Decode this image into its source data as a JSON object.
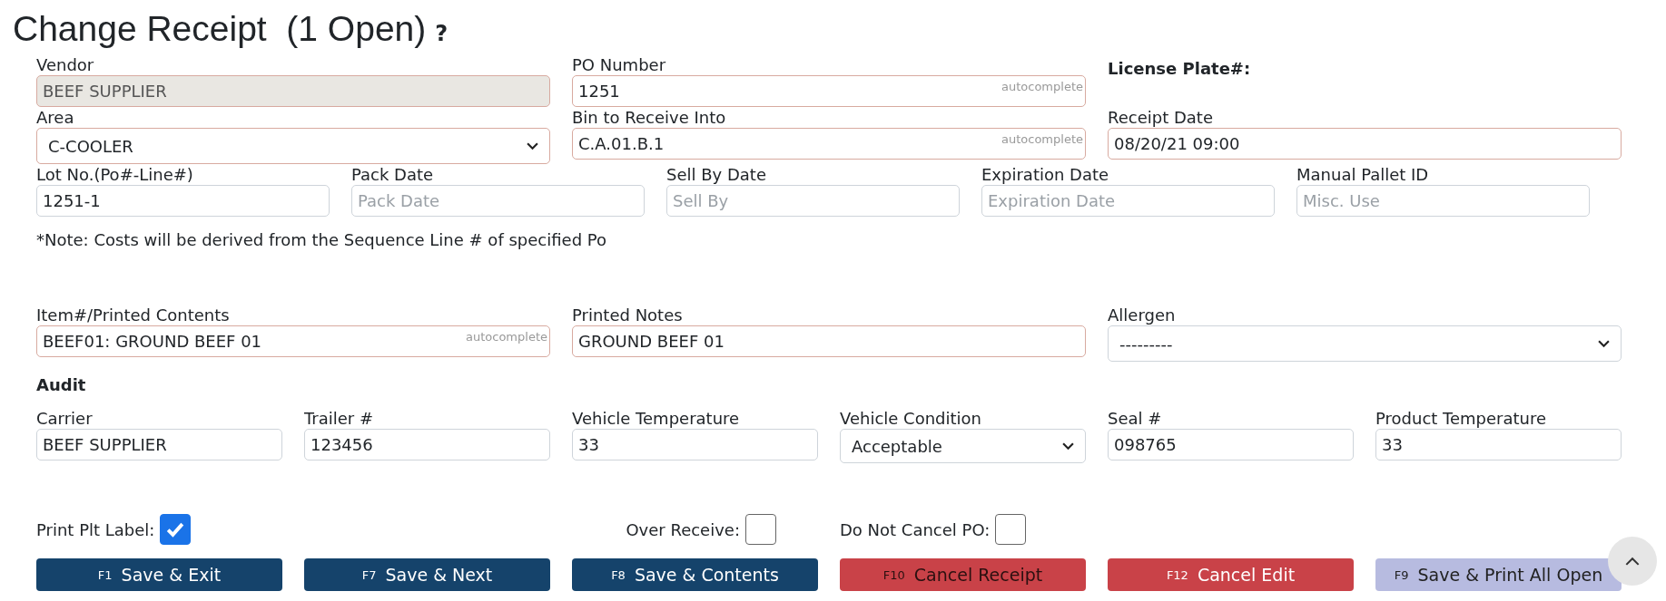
{
  "header": {
    "title": "Change Receipt",
    "open_count": "(1 Open)",
    "help": "?"
  },
  "rows": [
    {
      "fields": [
        {
          "label": "Vendor",
          "kind": "readonly",
          "value": "BEEF SUPPLIER",
          "required": true
        },
        {
          "label": "PO Number",
          "kind": "text",
          "value": "1251",
          "hint": "autocomplete",
          "required": true
        },
        {
          "label": "License Plate#:",
          "kind": "heading"
        }
      ]
    },
    {
      "fields": [
        {
          "label": "Area",
          "kind": "select",
          "value": "C-COOLER",
          "required": true
        },
        {
          "label": "Bin to Receive Into",
          "kind": "text",
          "value": "C.A.01.B.1",
          "hint": "autocomplete",
          "required": true
        },
        {
          "label": "Receipt Date",
          "kind": "text",
          "value": "08/20/21 09:00",
          "required": true
        }
      ]
    },
    {
      "fields": [
        {
          "label": "Lot No.(Po#-Line#)",
          "kind": "text",
          "value": "1251-1",
          "required": false
        },
        {
          "label": "Pack Date",
          "kind": "text",
          "placeholder": "Pack Date",
          "required": false
        },
        {
          "label": "Sell By Date",
          "kind": "text",
          "placeholder": "Sell By",
          "required": false
        },
        {
          "label": "Expiration Date",
          "kind": "text",
          "placeholder": "Expiration Date",
          "required": false
        },
        {
          "label": "Manual Pallet ID",
          "kind": "text",
          "placeholder": "Misc. Use",
          "required": false
        }
      ]
    }
  ],
  "note": "*Note: Costs will be derived from the Sequence Line # of specified Po",
  "item_row": {
    "fields": [
      {
        "label": "Item#/Printed Contents",
        "kind": "text",
        "value": "BEEF01: GROUND BEEF 01",
        "hint": "autocomplete",
        "required": true
      },
      {
        "label": "Printed Notes",
        "kind": "text",
        "value": "GROUND BEEF 01",
        "required": true
      },
      {
        "label": "Allergen",
        "kind": "select",
        "value": "---------",
        "required": false
      }
    ]
  },
  "audit": {
    "title": "Audit",
    "fields": [
      {
        "label": "Carrier",
        "kind": "text",
        "value": "BEEF SUPPLIER",
        "required": false
      },
      {
        "label": "Trailer #",
        "kind": "text",
        "value": "123456",
        "required": false
      },
      {
        "label": "Vehicle Temperature",
        "kind": "text",
        "value": "33",
        "required": false
      },
      {
        "label": "Vehicle Condition",
        "kind": "select",
        "value": "Acceptable",
        "required": false
      },
      {
        "label": "Seal #",
        "kind": "text",
        "value": "098765",
        "required": false
      },
      {
        "label": "Product Temperature",
        "kind": "text",
        "value": "33",
        "required": false
      }
    ]
  },
  "checkboxes": [
    {
      "label": "Print Plt Label:",
      "checked": true
    },
    {
      "label": "Over Receive:",
      "checked": false
    },
    {
      "label": "Do Not Cancel PO:",
      "checked": false
    }
  ],
  "buttons": [
    {
      "key": "F1",
      "label": "Save & Exit",
      "kind": "primary"
    },
    {
      "key": "F7",
      "label": "Save & Next",
      "kind": "primary"
    },
    {
      "key": "F8",
      "label": "Save & Contents",
      "kind": "primary"
    },
    {
      "key": "F10",
      "label": "Cancel Receipt",
      "kind": "danger"
    },
    {
      "key": "F12",
      "label": "Cancel Edit",
      "kind": "danger_light"
    },
    {
      "key": "F9",
      "label": "Save & Print All Open",
      "kind": "muted"
    }
  ]
}
